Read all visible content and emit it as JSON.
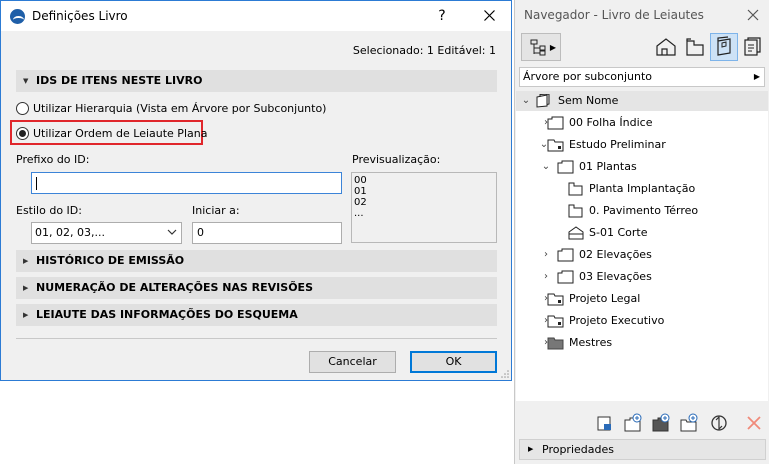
{
  "dialog": {
    "title": "Definições Livro",
    "help_label": "?",
    "selected_info": "Selecionado: 1 Editável: 1",
    "section_ids": "IDS DE ITENS NESTE LIVRO",
    "radio_hierarchy": "Utilizar Hierarquia (Vista em Árvore por Subconjunto)",
    "radio_flat": "Utilizar Ordem de Leiaute Plana",
    "prefix_label": "Prefixo do ID:",
    "prefix_value": "",
    "preview_label": "Previsualização:",
    "preview_lines": [
      "00",
      "01",
      "02",
      "..."
    ],
    "style_label": "Estilo do ID:",
    "style_value": "01, 02, 03,...",
    "start_label": "Iniciar a:",
    "start_value": "0",
    "section_history": "HISTÓRICO DE EMISSÃO",
    "section_numbering": "NUMERAÇÃO DE ALTERAÇÕES NAS REVISÕES",
    "section_layout": "LEIAUTE DAS INFORMAÇÕES DO ESQUEMA",
    "cancel_label": "Cancelar",
    "ok_label": "OK",
    "selected_radio": "flat"
  },
  "navigator": {
    "title": "Navegador - Livro de Leiautes",
    "mode": "Árvore por subconjunto",
    "tree": [
      {
        "label": "Sem Nome",
        "icon": "book-icon",
        "chevron": "down"
      },
      {
        "label": "00 Folha Índice",
        "icon": "subset-icon",
        "chevron": "right"
      },
      {
        "label": "Estudo Preliminar",
        "icon": "subset-folder-icon",
        "chevron": "down"
      },
      {
        "label": "01 Plantas",
        "icon": "subset-icon",
        "chevron": "down"
      },
      {
        "label": "Planta Implantação",
        "icon": "layout-icon",
        "chevron": ""
      },
      {
        "label": "0. Pavimento Térreo",
        "icon": "layout-icon",
        "chevron": ""
      },
      {
        "label": "S-01 Corte",
        "icon": "master-layout-icon",
        "chevron": ""
      },
      {
        "label": "02 Elevações",
        "icon": "subset-icon",
        "chevron": "right"
      },
      {
        "label": "03 Elevações",
        "icon": "subset-icon",
        "chevron": "right"
      },
      {
        "label": "Projeto Legal",
        "icon": "subset-folder-icon",
        "chevron": "right"
      },
      {
        "label": "Projeto Executivo",
        "icon": "subset-folder-icon",
        "chevron": "right"
      },
      {
        "label": "Mestres",
        "icon": "masters-folder-icon",
        "chevron": "right"
      }
    ],
    "properties_label": "Propriedades"
  },
  "colors": {
    "highlight": "#e0262b",
    "accent": "#0078d7",
    "delete_disabled": "#f08a7a"
  }
}
